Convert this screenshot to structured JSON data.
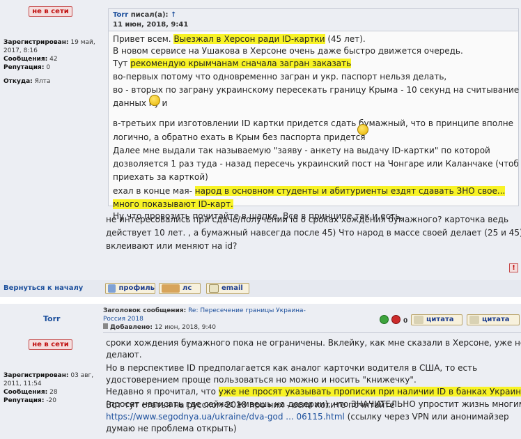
{
  "post1": {
    "status": "не в сети",
    "profile": {
      "registered_label": "Зарегистрирован:",
      "registered_value": "19 май, 2017, 8:16",
      "messages_label": "Сообщения:",
      "messages_value": "42",
      "reputation_label": "Репутация:",
      "reputation_value": "0",
      "from_label": "Откуда:",
      "from_value": "Ялта"
    },
    "quote": {
      "author": "Torr",
      "wrote": "писал(а):",
      "arrow": "↑",
      "date": "11 июн, 2018, 9:41",
      "lines": [
        {
          "pre": "Привет всем. ",
          "hl": "Выезжал в Херсон ради ID-картки",
          "post": " (45 лет)."
        },
        {
          "pre": "В новом сервисе на Ушакова в Херсоне очень даже быстро движется очередь.",
          "hl": "",
          "post": ""
        },
        {
          "pre": "Тут ",
          "hl": "рекомендую крымчанам сначала загран заказать",
          "post": ""
        },
        {
          "pre": "во-первых потому что одновременно загран и укр. паспорт нельзя делать,",
          "hl": "",
          "post": ""
        },
        {
          "pre": "во - вторых по заграну украинскому пересекать границу Крыма - 10 секунд на считывание",
          "hl": "",
          "post": ""
        },
        {
          "pre": "данных ",
          "hl": "",
          "post": " ну и"
        },
        {
          "pre": "в-третьих при изготовлении ID картки придется сдать бумажный, что в принципе вполне",
          "hl": "",
          "post": ""
        },
        {
          "pre": "логично, а обратно ехать в Крым без паспорта придется ",
          "hl": "",
          "post": ""
        },
        {
          "pre": "Далее мне выдали так называемую \"заяву - анкету на выдачу ID-картки\" по которой",
          "hl": "",
          "post": ""
        },
        {
          "pre": "дозволяется 1 раз туда - назад пересечь украинский пост на Чонгаре или Каланчаке (чтоб",
          "hl": "",
          "post": ""
        },
        {
          "pre": "приехать за карткой)",
          "hl": "",
          "post": ""
        },
        {
          "pre": "ехал в конце мая- ",
          "hl": "народ в основном студенты и абитуриенты ездят сдавать ЗНО свое...",
          "post": ""
        },
        {
          "pre": "",
          "hl": "много показывают ID-карт.",
          "post": ""
        },
        {
          "pre": "Ну что провозить почитайте в шапке. Все в принципе так и есть.",
          "hl": "",
          "post": ""
        }
      ]
    },
    "body_lines": [
      "не интересовались при сдаче/получении id о сроках хождения бумажного? карточка ведь",
      "действует 10 лет. , а бумажный навсегда после 45) Что народ в массе своей делает (25 и 45):",
      "вклеивают или меняют на id?"
    ],
    "back_to_top": "Вернуться к началу",
    "buttons": {
      "profile": "профиль",
      "pm": "лс",
      "email": "email"
    }
  },
  "post2": {
    "author": "Torr",
    "status": "не в сети",
    "profile": {
      "registered_label": "Зарегистрирован:",
      "registered_value": "03 авг, 2011, 11:54",
      "messages_label": "Сообщения:",
      "messages_value": "28",
      "reputation_label": "Репутация:",
      "reputation_value": "-20"
    },
    "subject_label": "Заголовок сообщения:",
    "subject_value": "Re: Пересечение границы Украина-Россия 2018",
    "added_label": "Добавлено:",
    "added_value": "12 июн, 2018, 9:40",
    "rating": "0",
    "quote_button": "цитата",
    "body_lines": [
      {
        "pre": "сроки хождения бумажного пока не ограничены. Вклейку, как мне сказали в Херсоне, уже не",
        "hl": "",
        "post": ""
      },
      {
        "pre": "делают.",
        "hl": "",
        "post": ""
      },
      {
        "pre": "Но в перспективе ID предполагается как аналог карточки водителя в США, то есть",
        "hl": "",
        "post": ""
      },
      {
        "pre": "удостоверением проще пользоваться но можно и носить \"книжечку\".",
        "hl": "",
        "post": ""
      },
      {
        "pre": "Недавно я прочитал, что ",
        "hl": "уже не просят указывать прописки при наличии ID в банках Украины",
        "post": ""
      },
      {
        "pre": "(просят написать где сейчас живешь на доверии), что ЗНАЧИТЕЛЬНО упростит жизнь многим.",
        "hl": "",
        "post": ""
      },
      {
        "pre": "Вот тут статья на русском 2018 про них - если хотите почитайте",
        "hl": "",
        "post": ""
      }
    ],
    "link_text": "https://www.segodnya.ua/ukraine/dva-god ... 06115.html",
    "link_after": " (ссылку через VPN или анонимайзер",
    "last_line": "думаю не проблема открыть)"
  },
  "colors": {
    "highlight": "#f8f325",
    "panel": "#eceef3",
    "link": "#1c4f9c",
    "offline": "#c01010"
  }
}
